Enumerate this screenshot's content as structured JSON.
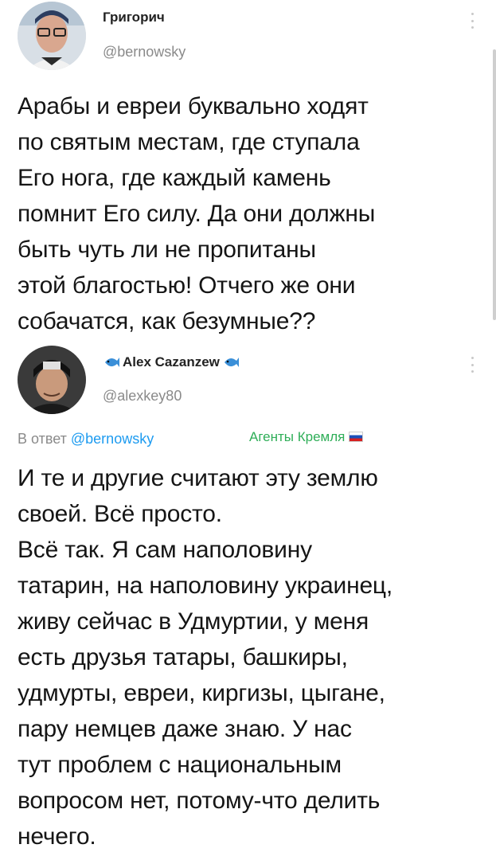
{
  "tweet1": {
    "name": "Григорич",
    "handle": "@bernowsky",
    "text": "Арабы и евреи буквально ходят\nпо святым местам, где ступала\nЕго нога, где каждый камень\nпомнит Его силу. Да они должны\nбыть чуть ли не пропитаны\nэтой благостью! Отчего же они\nсобачатся, как безумные??"
  },
  "tweet2": {
    "name": "Alex Cazanzew",
    "handle": "@alexkey80",
    "reply_prefix": "В ответ ",
    "reply_to": "@bernowsky",
    "tag": "Агенты Кремля",
    "text": "И те и другие считают эту землю\nсвоей. Всё просто.\nВсё так. Я сам наполовину\nтатарин, на наполовину украинец,\nживу сейчас в Удмуртии, у меня\nесть друзья татары, башкиры,\nудмурты, евреи, киргизы,  цыгане,\nпару немцев даже знаю. У нас\nтут проблем с национальным\nвопросом нет, потому-что делить\nнечего."
  },
  "colors": {
    "accent": "#1d9bf0",
    "tag_green": "#2fae58",
    "muted": "#8a8a8a"
  },
  "icons": {
    "fish": "blue-fish-emoji",
    "flag": "russia-flag"
  }
}
